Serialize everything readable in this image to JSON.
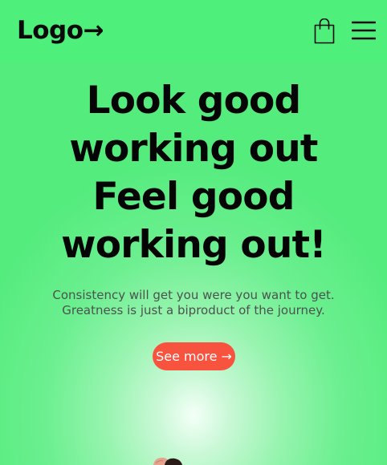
{
  "header": {
    "logo": "Logo→",
    "bag_icon": "shopping-bag-icon",
    "menu_icon": "hamburger-menu-icon"
  },
  "hero": {
    "title_lines": [
      "Look good",
      "working out",
      "Feel good",
      "working out!"
    ],
    "subtitle_lines": [
      "Consistency will get you were you want to get.",
      "Greatness is just a biproduct of the journey."
    ],
    "cta_label": "See more →"
  },
  "colors": {
    "header_bg": "#4ef07b",
    "page_bg": "#55ec7e",
    "cta_bg": "#f8533e",
    "title_text": "#050505",
    "subtitle_text": "#4b524e"
  }
}
